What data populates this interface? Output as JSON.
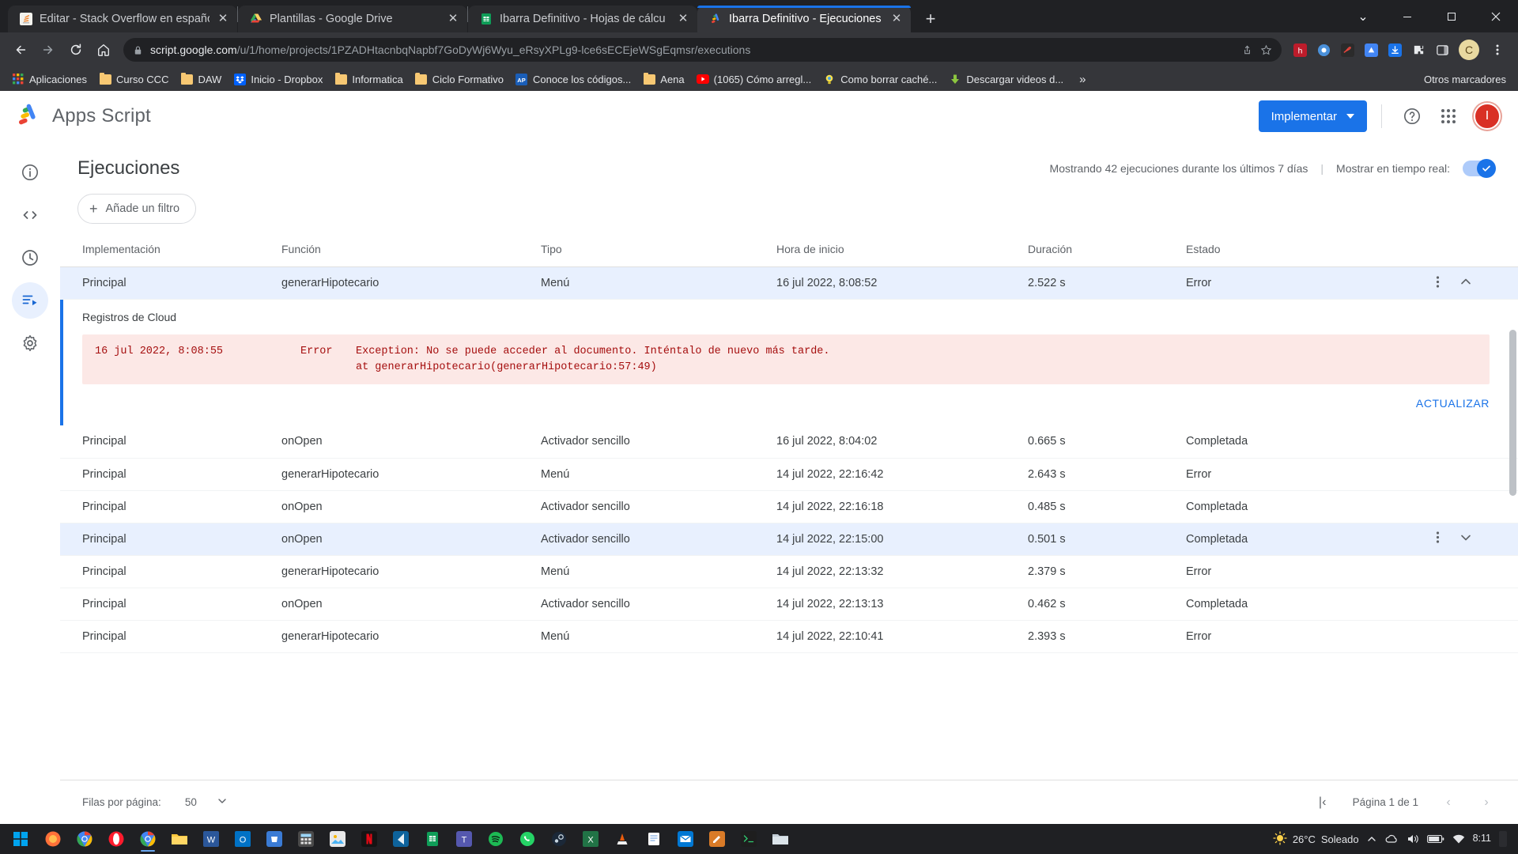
{
  "browser": {
    "tabs": [
      {
        "title": "Editar - Stack Overflow en español",
        "favicon": "stackoverflow-icon",
        "active": false
      },
      {
        "title": "Plantillas - Google Drive",
        "favicon": "google-drive-icon",
        "active": false
      },
      {
        "title": "Ibarra Definitivo - Hojas de cálcu",
        "favicon": "google-sheets-icon",
        "active": false
      },
      {
        "title": "Ibarra Definitivo - Ejecuciones de",
        "favicon": "apps-script-icon",
        "active": true
      }
    ],
    "new_tab_label": "+",
    "window_controls": {
      "minimize": "—",
      "maximize": "❐",
      "close": "✕",
      "restore": "⌄"
    },
    "nav": {
      "back": "←",
      "forward": "→",
      "reload": "↻",
      "home": "⌂"
    },
    "omnibox": {
      "domain": "script.google.com",
      "path": "/u/1/home/projects/1PZADHtacnbqNapbf7GoDyWj6Wyu_eRsyXPLg9-lce6sECEjeWSgEqmsr/executions",
      "lock_icon": "lock-icon",
      "share_icon": "share-icon",
      "star_icon": "star-icon"
    },
    "profile_initial": "C",
    "bookmarks": [
      {
        "label": "Aplicaciones",
        "icon": "apps-grid-icon"
      },
      {
        "label": "Curso CCC",
        "icon": "folder-icon"
      },
      {
        "label": "DAW",
        "icon": "folder-icon"
      },
      {
        "label": "Inicio - Dropbox",
        "icon": "dropbox-icon"
      },
      {
        "label": "Informatica",
        "icon": "folder-icon"
      },
      {
        "label": "Ciclo Formativo",
        "icon": "folder-icon"
      },
      {
        "label": "Conoce los códigos...",
        "icon": "ap-icon"
      },
      {
        "label": "Aena",
        "icon": "folder-icon"
      },
      {
        "label": "(1065) Cómo arregl...",
        "icon": "youtube-icon"
      },
      {
        "label": "Como borrar caché...",
        "icon": "lightbulb-icon"
      },
      {
        "label": "Descargar videos d...",
        "icon": "download-icon"
      }
    ],
    "bookmarks_overflow": "»",
    "other_bookmarks": "Otros marcadores"
  },
  "app": {
    "brand": "Apps Script",
    "deploy_button": "Implementar",
    "help_icon": "help-icon",
    "apps_icon": "google-apps-grid-icon",
    "avatar_initial": "I",
    "rail": [
      {
        "name": "overview",
        "icon": "info-icon",
        "active": false
      },
      {
        "name": "editor",
        "icon": "code-icon",
        "active": false
      },
      {
        "name": "triggers",
        "icon": "clock-icon",
        "active": false
      },
      {
        "name": "executions",
        "icon": "executions-icon",
        "active": true
      },
      {
        "name": "settings",
        "icon": "gear-icon",
        "active": false
      }
    ]
  },
  "page": {
    "title": "Ejecuciones",
    "status_text": "Mostrando 42 ejecuciones durante los últimos 7 días",
    "separator": "|",
    "realtime_label": "Mostrar en tiempo real:",
    "realtime_on": true,
    "filter_label": "Añade un filtro",
    "filter_plus": "+"
  },
  "table": {
    "columns": [
      "Implementación",
      "Función",
      "Tipo",
      "Hora de inicio",
      "Duración",
      "Estado"
    ],
    "rows": [
      {
        "implementacion": "Principal",
        "funcion": "generarHipotecario",
        "tipo": "Menú",
        "hora": "16 jul 2022, 8:08:52",
        "duracion": "2.522 s",
        "estado": "Error",
        "error": true,
        "expanded": true,
        "selected": true,
        "menu_icon": "kebab-menu-icon",
        "chevron": "⌃"
      },
      {
        "implementacion": "Principal",
        "funcion": "onOpen",
        "tipo": "Activador sencillo",
        "hora": "16 jul 2022, 8:04:02",
        "duracion": "0.665 s",
        "estado": "Completada",
        "error": false,
        "expanded": false,
        "selected": false
      },
      {
        "implementacion": "Principal",
        "funcion": "generarHipotecario",
        "tipo": "Menú",
        "hora": "14 jul 2022, 22:16:42",
        "duracion": "2.643 s",
        "estado": "Error",
        "error": true,
        "expanded": false,
        "selected": false
      },
      {
        "implementacion": "Principal",
        "funcion": "onOpen",
        "tipo": "Activador sencillo",
        "hora": "14 jul 2022, 22:16:18",
        "duracion": "0.485 s",
        "estado": "Completada",
        "error": false,
        "expanded": false,
        "selected": false
      },
      {
        "implementacion": "Principal",
        "funcion": "onOpen",
        "tipo": "Activador sencillo",
        "hora": "14 jul 2022, 22:15:00",
        "duracion": "0.501 s",
        "estado": "Completada",
        "error": false,
        "expanded": false,
        "selected": true,
        "menu_icon": "kebab-menu-icon",
        "chevron": "⌄"
      },
      {
        "implementacion": "Principal",
        "funcion": "generarHipotecario",
        "tipo": "Menú",
        "hora": "14 jul 2022, 22:13:32",
        "duracion": "2.379 s",
        "estado": "Error",
        "error": true,
        "expanded": false,
        "selected": false
      },
      {
        "implementacion": "Principal",
        "funcion": "onOpen",
        "tipo": "Activador sencillo",
        "hora": "14 jul 2022, 22:13:13",
        "duracion": "0.462 s",
        "estado": "Completada",
        "error": false,
        "expanded": false,
        "selected": false
      },
      {
        "implementacion": "Principal",
        "funcion": "generarHipotecario",
        "tipo": "Menú",
        "hora": "14 jul 2022, 22:10:41",
        "duracion": "2.393 s",
        "estado": "Error",
        "error": true,
        "expanded": false,
        "selected": false
      }
    ]
  },
  "detail": {
    "title": "Registros de Cloud",
    "log": {
      "timestamp": "16 jul 2022, 8:08:55",
      "severity": "Error",
      "message": "Exception: No se puede acceder al documento. Inténtalo de nuevo más tarde.",
      "stack": "at generarHipotecario(generarHipotecario:57:49)"
    },
    "refresh_button": "ACTUALIZAR"
  },
  "pager": {
    "rows_label": "Filas por página:",
    "rows_value": "50",
    "page_label": "Página 1 de 1",
    "first": "|‹",
    "prev": "‹",
    "next": "›"
  },
  "taskbar": {
    "start_icon": "windows-start-icon",
    "items": [
      {
        "name": "firefox-icon"
      },
      {
        "name": "chrome-icon"
      },
      {
        "name": "opera-icon"
      },
      {
        "name": "chrome-active-icon"
      },
      {
        "name": "explorer-icon"
      },
      {
        "name": "word-icon"
      },
      {
        "name": "outlook-icon"
      },
      {
        "name": "store-icon"
      },
      {
        "name": "calculator-icon"
      },
      {
        "name": "photos-icon"
      },
      {
        "name": "netflix-icon"
      },
      {
        "name": "vscode-icon"
      },
      {
        "name": "sheets-icon"
      },
      {
        "name": "teams-icon"
      },
      {
        "name": "spotify-icon"
      },
      {
        "name": "whatsapp-icon"
      },
      {
        "name": "steam-icon"
      },
      {
        "name": "excel-icon"
      },
      {
        "name": "vlc-icon"
      },
      {
        "name": "notepad-icon"
      },
      {
        "name": "mail-icon"
      },
      {
        "name": "editor-icon"
      },
      {
        "name": "terminal-icon"
      },
      {
        "name": "folder-icon"
      }
    ],
    "weather_temp": "26°C",
    "weather_desc": "Soleado",
    "weather_icon": "sun-icon",
    "tray_chevron": "⌃",
    "tray_icons": [
      "onedrive-icon",
      "volume-icon",
      "battery-icon",
      "network-icon"
    ],
    "clock_time": "8:11",
    "notification_icon": "notification-icon"
  },
  "colors": {
    "accent": "#1a73e8",
    "error": "#c5221f",
    "error_bg": "#fce8e6",
    "row_selected": "#e8f0fe",
    "chrome_bg": "#35363a",
    "chrome_dark": "#202124"
  }
}
